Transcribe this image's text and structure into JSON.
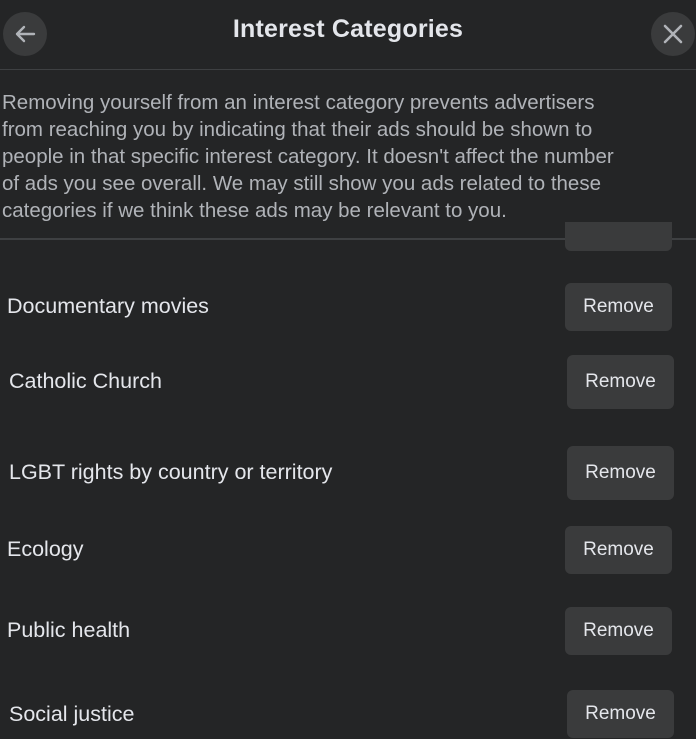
{
  "header": {
    "title": "Interest Categories",
    "back_icon": "arrow-left-icon",
    "close_icon": "close-icon"
  },
  "description_lines": [
    "Removing yourself from an interest category prevents advertisers",
    "from reaching you by indicating that their ads should be shown to",
    "people in that specific interest category. It doesn't affect the number",
    "of ads you see overall. We may still show you ads related to these",
    "categories if we think these ads may be relevant to you."
  ],
  "categories": [
    {
      "label": "Documentary movies",
      "button": "Remove"
    },
    {
      "label": "Catholic Church",
      "button": "Remove"
    },
    {
      "label": "LGBT rights by country or territory",
      "button": "Remove"
    },
    {
      "label": "Ecology",
      "button": "Remove"
    },
    {
      "label": "Public health",
      "button": "Remove"
    },
    {
      "label": "Social justice",
      "button": "Remove"
    }
  ],
  "colors": {
    "background": "#242526",
    "button": "#3a3b3c",
    "primary_text": "#e4e6eb",
    "secondary_text": "#b0b3b8"
  }
}
